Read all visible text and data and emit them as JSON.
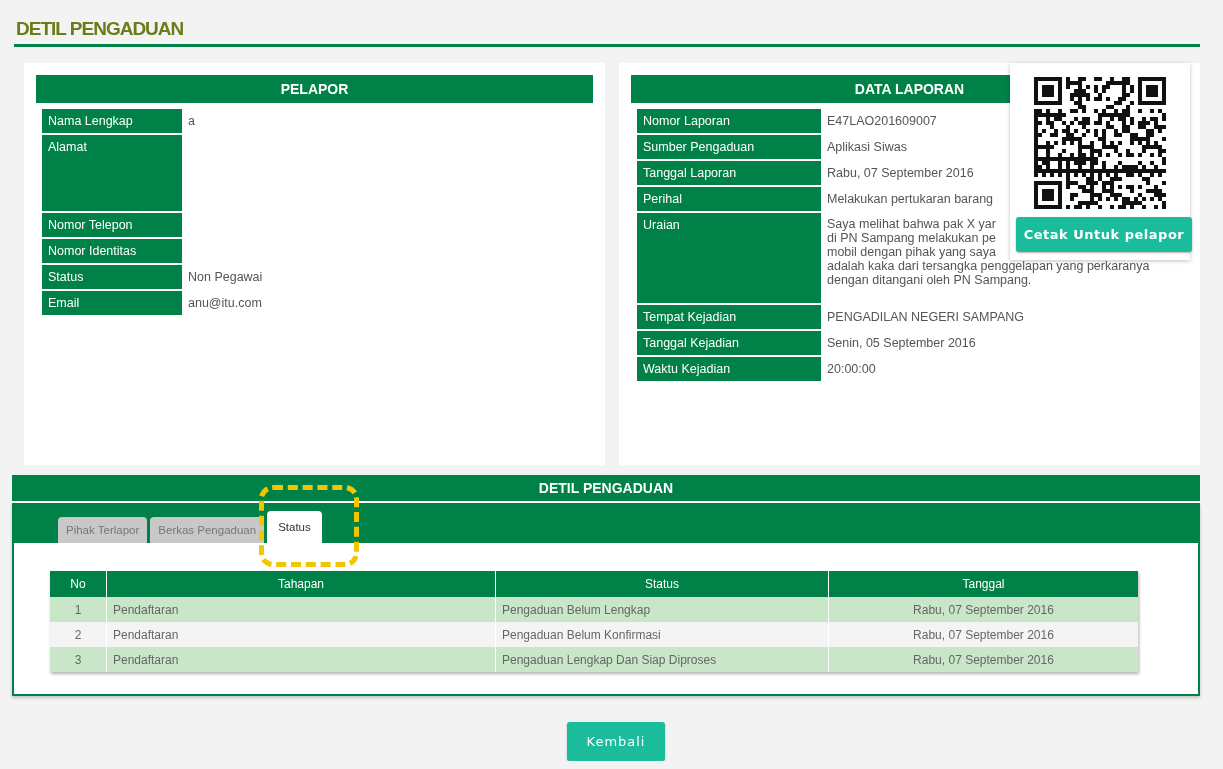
{
  "page_title": "DETIL PENGADUAN",
  "pelapor": {
    "title": "PELAPOR",
    "rows": [
      {
        "label": "Nama Lengkap",
        "value": "a",
        "kind": "line"
      },
      {
        "label": "Alamat",
        "kind": "tall"
      },
      {
        "label": "Nomor Telepon",
        "kind": "line"
      },
      {
        "label": "Nomor Identitas",
        "kind": "line"
      },
      {
        "label": "Status",
        "value": "Non Pegawai",
        "kind": "line"
      },
      {
        "label": "Email",
        "value": "anu@itu.com",
        "kind": "line"
      }
    ]
  },
  "data_laporan": {
    "title": "DATA LAPORAN",
    "rows": [
      {
        "label": "Nomor Laporan",
        "value": "E47LAO201609007",
        "kind": "line"
      },
      {
        "label": "Sumber Pengaduan",
        "value": "Aplikasi Siwas",
        "kind": "line"
      },
      {
        "label": "Tanggal Laporan",
        "value": "Rabu, 07 September 2016",
        "kind": "line"
      },
      {
        "label": "Perihal",
        "value": "Melakukan pertukaran barang",
        "kind": "line"
      },
      {
        "label": "Uraian",
        "kind": "lines",
        "lines": [
          "Saya melihat bahwa pak X yar",
          "di PN Sampang melakukan pe",
          "mobil dengan pihak yang saya",
          "adalah kaka dari tersangka penggelapan yang perkaranya",
          "dengan ditangani oleh PN Sampang."
        ]
      },
      {
        "label": "Tempat Kejadian",
        "value": "PENGADILAN NEGERI SAMPANG",
        "kind": "line"
      },
      {
        "label": "Tanggal Kejadian",
        "value": "Senin, 05 September 2016",
        "kind": "line"
      },
      {
        "label": "Waktu Kejadian",
        "value": "20:00:00",
        "kind": "line"
      }
    ]
  },
  "qr_popup": {
    "button": "Cetak Untuk pelapor"
  },
  "detail": {
    "title": "DETIL PENGADUAN",
    "tabs": [
      {
        "label": "Pihak Terlapor",
        "selected": false,
        "highlighted": false
      },
      {
        "label": "Berkas Pengaduan",
        "selected": false,
        "highlighted": false
      },
      {
        "label": "Status",
        "selected": true,
        "highlighted": true
      }
    ],
    "table": {
      "columns": [
        "No",
        "Tahapan",
        "Status",
        "Tanggal"
      ],
      "rows": [
        [
          "1",
          "Pendaftaran",
          "Pengaduan Belum Lengkap",
          "Rabu, 07 September 2016"
        ],
        [
          "2",
          "Pendaftaran",
          "Pengaduan Belum Konfirmasi",
          "Rabu, 07 September 2016"
        ],
        [
          "3",
          "Pendaftaran",
          "Pengaduan Lengkap Dan Siap Diproses",
          "Rabu, 07 September 2016"
        ]
      ]
    }
  },
  "back_button": "Kembali"
}
